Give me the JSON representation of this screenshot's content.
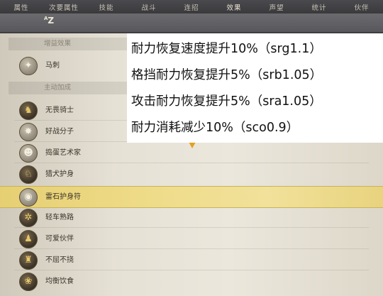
{
  "tabs": [
    "属性",
    "次要属性",
    "技能",
    "战斗",
    "连招",
    "效果",
    "声望",
    "统计",
    "伙伴"
  ],
  "active_tab_index": 5,
  "sort_icon": "sort-az-icon",
  "sort_label": "AZ",
  "sections": {
    "beneficial": "增益效果",
    "active": "主动加成"
  },
  "items": [
    {
      "label": "马刺",
      "icon": "spur-icon"
    },
    {
      "label": "无畏骑士",
      "icon": "knight-icon"
    },
    {
      "label": "好战分子",
      "icon": "warmonger-icon"
    },
    {
      "label": "捣蛋艺术家",
      "icon": "prankster-icon"
    },
    {
      "label": "猎犬护身",
      "icon": "hound-icon"
    },
    {
      "label": "雷石护身符",
      "icon": "thunderstone-icon"
    },
    {
      "label": "轻车熟路",
      "icon": "road-icon"
    },
    {
      "label": "可爱伙伴",
      "icon": "companion-icon"
    },
    {
      "label": "不屈不挠",
      "icon": "tenacity-icon"
    },
    {
      "label": "均衡饮食",
      "icon": "food-icon"
    }
  ],
  "selected_index": 5,
  "overlay": [
    "耐力恢复速度提升10%（srg1.1）",
    "格挡耐力恢复提升5%（srb1.05）",
    "攻击耐力恢复提升5%（sra1.05）",
    "耐力消耗减少10%（sco0.9）"
  ],
  "colors": {
    "selected_row": "#efdc8a",
    "tabbar": "#3f3f42",
    "panel": "#e6e1d5"
  }
}
